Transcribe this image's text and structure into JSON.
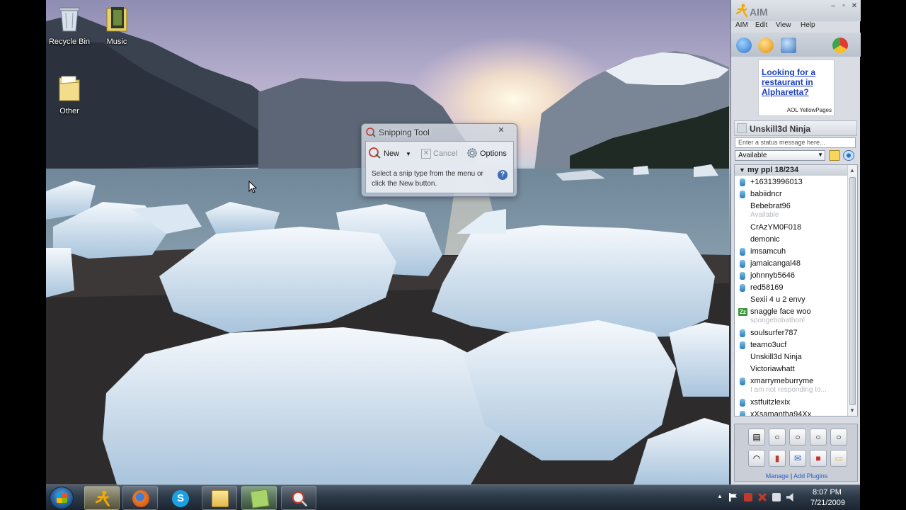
{
  "desktop": {
    "icons": [
      {
        "label": "Recycle Bin",
        "icon": "recycle-bin-icon"
      },
      {
        "label": "Music",
        "icon": "music-folder-icon"
      },
      {
        "label": "Other",
        "icon": "folder-icon"
      }
    ]
  },
  "snipping_tool": {
    "title": "Snipping Tool",
    "new_label": "New",
    "cancel_label": "Cancel",
    "options_label": "Options",
    "hint": "Select a snip type from the menu or click the New button.",
    "help_icon": "?"
  },
  "aim": {
    "title": "AIM",
    "menu": [
      "AIM",
      "Edit",
      "View",
      "Help"
    ],
    "ad": {
      "text": "Looking for a restaurant in Alpharetta?",
      "brand": "AOL YellowPages"
    },
    "user": "Unskill3d Ninja",
    "status_placeholder": "Enter a status message here...",
    "availability": "Available",
    "group": {
      "name": "my ppl 18/234"
    },
    "buddies": [
      {
        "name": "+16313996013",
        "icon": "mobile"
      },
      {
        "name": "babiidncr",
        "icon": "mobile"
      },
      {
        "name": "Bebebrat96",
        "icon": "",
        "sub": "Available"
      },
      {
        "name": "CrAzYM0F018",
        "icon": ""
      },
      {
        "name": "demonic",
        "icon": ""
      },
      {
        "name": "imsamcuh",
        "icon": "mobile"
      },
      {
        "name": "jamaicangal48",
        "icon": "mobile"
      },
      {
        "name": "johnnyb5646",
        "icon": "mobile"
      },
      {
        "name": "red58169",
        "icon": "mobile"
      },
      {
        "name": "Sexii 4 u 2 envy",
        "icon": ""
      },
      {
        "name": "snaggle face woo",
        "icon": "idle",
        "sub": "spongebobathon!"
      },
      {
        "name": "soulsurfer787",
        "icon": "mobile"
      },
      {
        "name": "teamo3ucf",
        "icon": "mobile"
      },
      {
        "name": "Unskill3d Ninja",
        "icon": ""
      },
      {
        "name": "Victoriawhatt",
        "icon": ""
      },
      {
        "name": "xmarrymeburryme",
        "icon": "mobile",
        "sub": "I am not responding to..."
      },
      {
        "name": "xstfuitzlexix",
        "icon": "mobile"
      },
      {
        "name": "xXsamantha94Xx",
        "icon": "mobile"
      }
    ],
    "plugins_manage": "Manage",
    "plugins_add": "Add Plugins"
  },
  "taskbar": {
    "apps": [
      "aim-running-man-icon",
      "firefox-icon",
      "skype-icon",
      "explorer-folder-icon",
      "sticky-notes-icon",
      "snipping-tool-icon"
    ],
    "time": "8:07 PM",
    "date": "7/21/2009"
  },
  "colors": {
    "taskbar": "#2c3947",
    "aim_accent": "#f2a900",
    "link": "#1d40b8"
  }
}
